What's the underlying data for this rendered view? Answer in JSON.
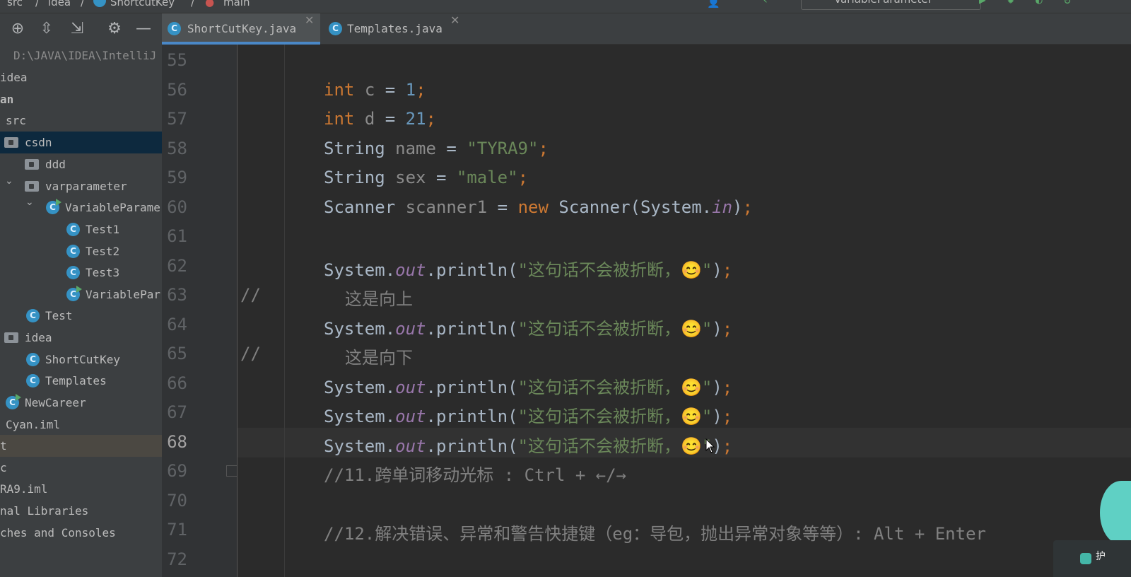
{
  "breadcrumb": {
    "items": [
      "src",
      "idea",
      "ShortcutKey",
      "main"
    ],
    "run_config": "VariableParameter"
  },
  "project_panel": {
    "tree": [
      {
        "label": "D:\\JAVA\\IDEA\\IntelliJ",
        "type": "path"
      },
      {
        "label": "idea",
        "type": "text"
      },
      {
        "label": "an",
        "type": "bold"
      },
      {
        "label": "src",
        "type": "text"
      },
      {
        "label": "csdn",
        "type": "folder",
        "selected": true
      },
      {
        "label": "ddd",
        "type": "folder"
      },
      {
        "label": "varparameter",
        "type": "folder"
      },
      {
        "label": "VariableParame",
        "type": "class-run"
      },
      {
        "label": "Test1",
        "type": "class"
      },
      {
        "label": "Test2",
        "type": "class"
      },
      {
        "label": "Test3",
        "type": "class"
      },
      {
        "label": "VariablePar",
        "type": "class-run"
      },
      {
        "label": "Test",
        "type": "class"
      },
      {
        "label": "idea",
        "type": "folder"
      },
      {
        "label": "ShortCutKey",
        "type": "class"
      },
      {
        "label": "Templates",
        "type": "class"
      },
      {
        "label": "NewCareer",
        "type": "class-run"
      },
      {
        "label": "Cyan.iml",
        "type": "text"
      },
      {
        "label": "t",
        "type": "text"
      },
      {
        "label": "c",
        "type": "text"
      },
      {
        "label": "RA9.iml",
        "type": "text"
      },
      {
        "label": "nal Libraries",
        "type": "text"
      },
      {
        "label": "ches and Consoles",
        "type": "text"
      }
    ]
  },
  "tabs": [
    {
      "label": "ShortCutKey.java",
      "active": true
    },
    {
      "label": "Templates.java",
      "active": false
    }
  ],
  "editor": {
    "current_line": "68",
    "line_numbers": [
      "55",
      "56",
      "57",
      "58",
      "59",
      "60",
      "61",
      "62",
      "63",
      "64",
      "65",
      "66",
      "67",
      "68",
      "69",
      "70",
      "71",
      "72"
    ],
    "lines": {
      "l56": {
        "kw": "int",
        "var": "c",
        "op": " = ",
        "num": "1",
        "end": ";"
      },
      "l57": {
        "kw": "int",
        "var": "d",
        "op": " = ",
        "num": "21",
        "end": ";"
      },
      "l58": {
        "type": "String",
        "var": "name",
        "op": " = ",
        "str": "\"TYRA9\"",
        "end": ";"
      },
      "l59": {
        "type": "String",
        "var": "sex",
        "op": " = ",
        "str": "\"male\"",
        "end": ";"
      },
      "l60": {
        "type": "Scanner",
        "var": "scanner1",
        "op": " = ",
        "kw": "new",
        "ctor": "Scanner(System.",
        "fld": "in",
        "close": ")",
        "end": ";"
      },
      "print_prefix": "System.",
      "print_field": "out",
      "print_method": ".println(",
      "print_str": "\"这句话不会被折断，😊\"",
      "print_close": ")",
      "print_end": ";",
      "l63_marker": "//",
      "l63_text": "这是向上",
      "l65_marker": "//",
      "l65_text": "这是向下",
      "l69": "//11.跨单词移动光标 : Ctrl + ←/→",
      "l71": "//12.解决错误、异常和警告快捷键（eg：导包，抛出异常对象等等）: Alt + Enter"
    }
  },
  "notification": {
    "text": "护"
  },
  "colors": {
    "panel_bg": "#3c3f41",
    "editor_bg": "#2b2b2b",
    "keyword": "#cc7832",
    "number": "#6897bb",
    "string": "#6a8759",
    "comment": "#808080",
    "field": "#9876aa",
    "selection": "#0d293e",
    "tab_underline": "#4a88c7"
  }
}
